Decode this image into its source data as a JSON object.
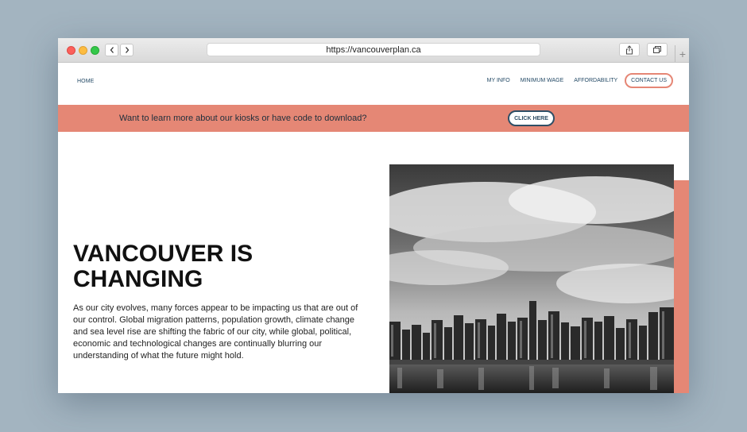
{
  "browser": {
    "url": "https://vancouverplan.ca",
    "back_icon": "chevron-left-icon",
    "forward_icon": "chevron-right-icon",
    "share_icon": "share-icon",
    "tabs_icon": "tabs-icon",
    "new_tab_label": "+"
  },
  "nav": {
    "home": "HOME",
    "items": [
      "MY INFO",
      "MINIMUM WAGE",
      "AFFORDABILITY"
    ],
    "contact": "CONTACT US"
  },
  "banner": {
    "text": "Want to learn more about our kiosks or have code to download?",
    "button": "CLICK HERE"
  },
  "hero": {
    "title": "VANCOUVER IS CHANGING",
    "body": "As our city evolves, many forces appear to be impacting us that are out of our control. Global migration patterns, population growth, climate change and sea level rise are shifting the fabric of our city, while global, political, economic and technological changes are continually blurring our understanding of what the future might hold."
  },
  "colors": {
    "accent": "#e58775",
    "navy": "#244a66",
    "text": "#111111"
  }
}
